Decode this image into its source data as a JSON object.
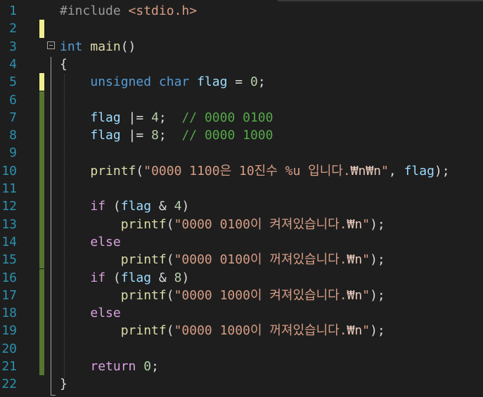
{
  "editor": {
    "colors": {
      "background": "#1e1e1e",
      "line_number": "#2b91af",
      "keyword": "#569cd6",
      "string": "#d69d85",
      "comment": "#57a64a",
      "number": "#b5cea8",
      "variable": "#9cdcfe",
      "function": "#dcdcaa",
      "change_saved": "#577430",
      "change_unsaved": "#efef91"
    },
    "lines": [
      {
        "n": "1",
        "change": "none",
        "tokens": [
          [
            "pp",
            "#include "
          ],
          [
            "hdr",
            "<stdio.h>"
          ]
        ]
      },
      {
        "n": "2",
        "change": "unsaved",
        "tokens": []
      },
      {
        "n": "3",
        "change": "none",
        "fold": true,
        "tokens": [
          [
            "kw",
            "int"
          ],
          [
            "",
            " "
          ],
          [
            "fn",
            "main"
          ],
          [
            "",
            "()"
          ]
        ]
      },
      {
        "n": "4",
        "change": "none",
        "tokens": [
          [
            "",
            "{"
          ]
        ]
      },
      {
        "n": "5",
        "change": "unsaved",
        "tokens": [
          [
            "",
            "    "
          ],
          [
            "kw",
            "unsigned char"
          ],
          [
            "",
            " "
          ],
          [
            "var",
            "flag"
          ],
          [
            "",
            " = "
          ],
          [
            "num",
            "0"
          ],
          [
            "",
            ";"
          ]
        ]
      },
      {
        "n": "6",
        "change": "saved",
        "tokens": []
      },
      {
        "n": "7",
        "change": "saved",
        "tokens": [
          [
            "",
            "    "
          ],
          [
            "var",
            "flag"
          ],
          [
            "",
            " |= "
          ],
          [
            "num",
            "4"
          ],
          [
            "",
            ";  "
          ],
          [
            "cm",
            "// 0000 0100"
          ]
        ]
      },
      {
        "n": "8",
        "change": "saved",
        "tokens": [
          [
            "",
            "    "
          ],
          [
            "var",
            "flag"
          ],
          [
            "",
            " |= "
          ],
          [
            "num",
            "8"
          ],
          [
            "",
            ";  "
          ],
          [
            "cm",
            "// 0000 1000"
          ]
        ]
      },
      {
        "n": "9",
        "change": "saved",
        "tokens": []
      },
      {
        "n": "10",
        "change": "saved",
        "tokens": [
          [
            "",
            "    "
          ],
          [
            "fn",
            "printf"
          ],
          [
            "",
            "("
          ],
          [
            "str",
            "\"0000 1100은 10진수 %u 입니다."
          ],
          [
            "esc",
            "₩n₩n"
          ],
          [
            "str",
            "\""
          ],
          [
            "",
            ", "
          ],
          [
            "var",
            "flag"
          ],
          [
            "",
            ");"
          ]
        ]
      },
      {
        "n": "11",
        "change": "saved",
        "tokens": []
      },
      {
        "n": "12",
        "change": "saved",
        "tokens": [
          [
            "",
            "    "
          ],
          [
            "ctl",
            "if"
          ],
          [
            "",
            " ("
          ],
          [
            "var",
            "flag"
          ],
          [
            "",
            " & "
          ],
          [
            "num",
            "4"
          ],
          [
            "",
            ")"
          ]
        ]
      },
      {
        "n": "13",
        "change": "saved",
        "tokens": [
          [
            "",
            "        "
          ],
          [
            "fn",
            "printf"
          ],
          [
            "",
            "("
          ],
          [
            "str",
            "\"0000 0100이 켜져있습니다."
          ],
          [
            "esc",
            "₩n"
          ],
          [
            "str",
            "\""
          ],
          [
            "",
            ");"
          ]
        ]
      },
      {
        "n": "14",
        "change": "saved",
        "tokens": [
          [
            "",
            "    "
          ],
          [
            "ctl",
            "else"
          ]
        ]
      },
      {
        "n": "15",
        "change": "saved",
        "tokens": [
          [
            "",
            "        "
          ],
          [
            "fn",
            "printf"
          ],
          [
            "",
            "("
          ],
          [
            "str",
            "\"0000 0100이 꺼져있습니다."
          ],
          [
            "esc",
            "₩n"
          ],
          [
            "str",
            "\""
          ],
          [
            "",
            ");"
          ]
        ]
      },
      {
        "n": "16",
        "change": "saved",
        "tokens": [
          [
            "",
            "    "
          ],
          [
            "ctl",
            "if"
          ],
          [
            "",
            " ("
          ],
          [
            "var",
            "flag"
          ],
          [
            "",
            " & "
          ],
          [
            "num",
            "8"
          ],
          [
            "",
            ")"
          ]
        ]
      },
      {
        "n": "17",
        "change": "saved",
        "tokens": [
          [
            "",
            "        "
          ],
          [
            "fn",
            "printf"
          ],
          [
            "",
            "("
          ],
          [
            "str",
            "\"0000 1000이 켜져있습니다."
          ],
          [
            "esc",
            "₩n"
          ],
          [
            "str",
            "\""
          ],
          [
            "",
            ");"
          ]
        ]
      },
      {
        "n": "18",
        "change": "saved",
        "tokens": [
          [
            "",
            "    "
          ],
          [
            "ctl",
            "else"
          ]
        ]
      },
      {
        "n": "19",
        "change": "saved",
        "tokens": [
          [
            "",
            "        "
          ],
          [
            "fn",
            "printf"
          ],
          [
            "",
            "("
          ],
          [
            "str",
            "\"0000 1000이 꺼져있습니다."
          ],
          [
            "esc",
            "₩n"
          ],
          [
            "str",
            "\""
          ],
          [
            "",
            ");"
          ]
        ]
      },
      {
        "n": "20",
        "change": "saved",
        "tokens": []
      },
      {
        "n": "21",
        "change": "saved",
        "tokens": [
          [
            "",
            "    "
          ],
          [
            "ctl",
            "return"
          ],
          [
            "",
            " "
          ],
          [
            "num",
            "0"
          ],
          [
            "",
            ";"
          ]
        ]
      },
      {
        "n": "22",
        "change": "none",
        "tokens": [
          [
            "",
            "}"
          ]
        ]
      }
    ]
  }
}
